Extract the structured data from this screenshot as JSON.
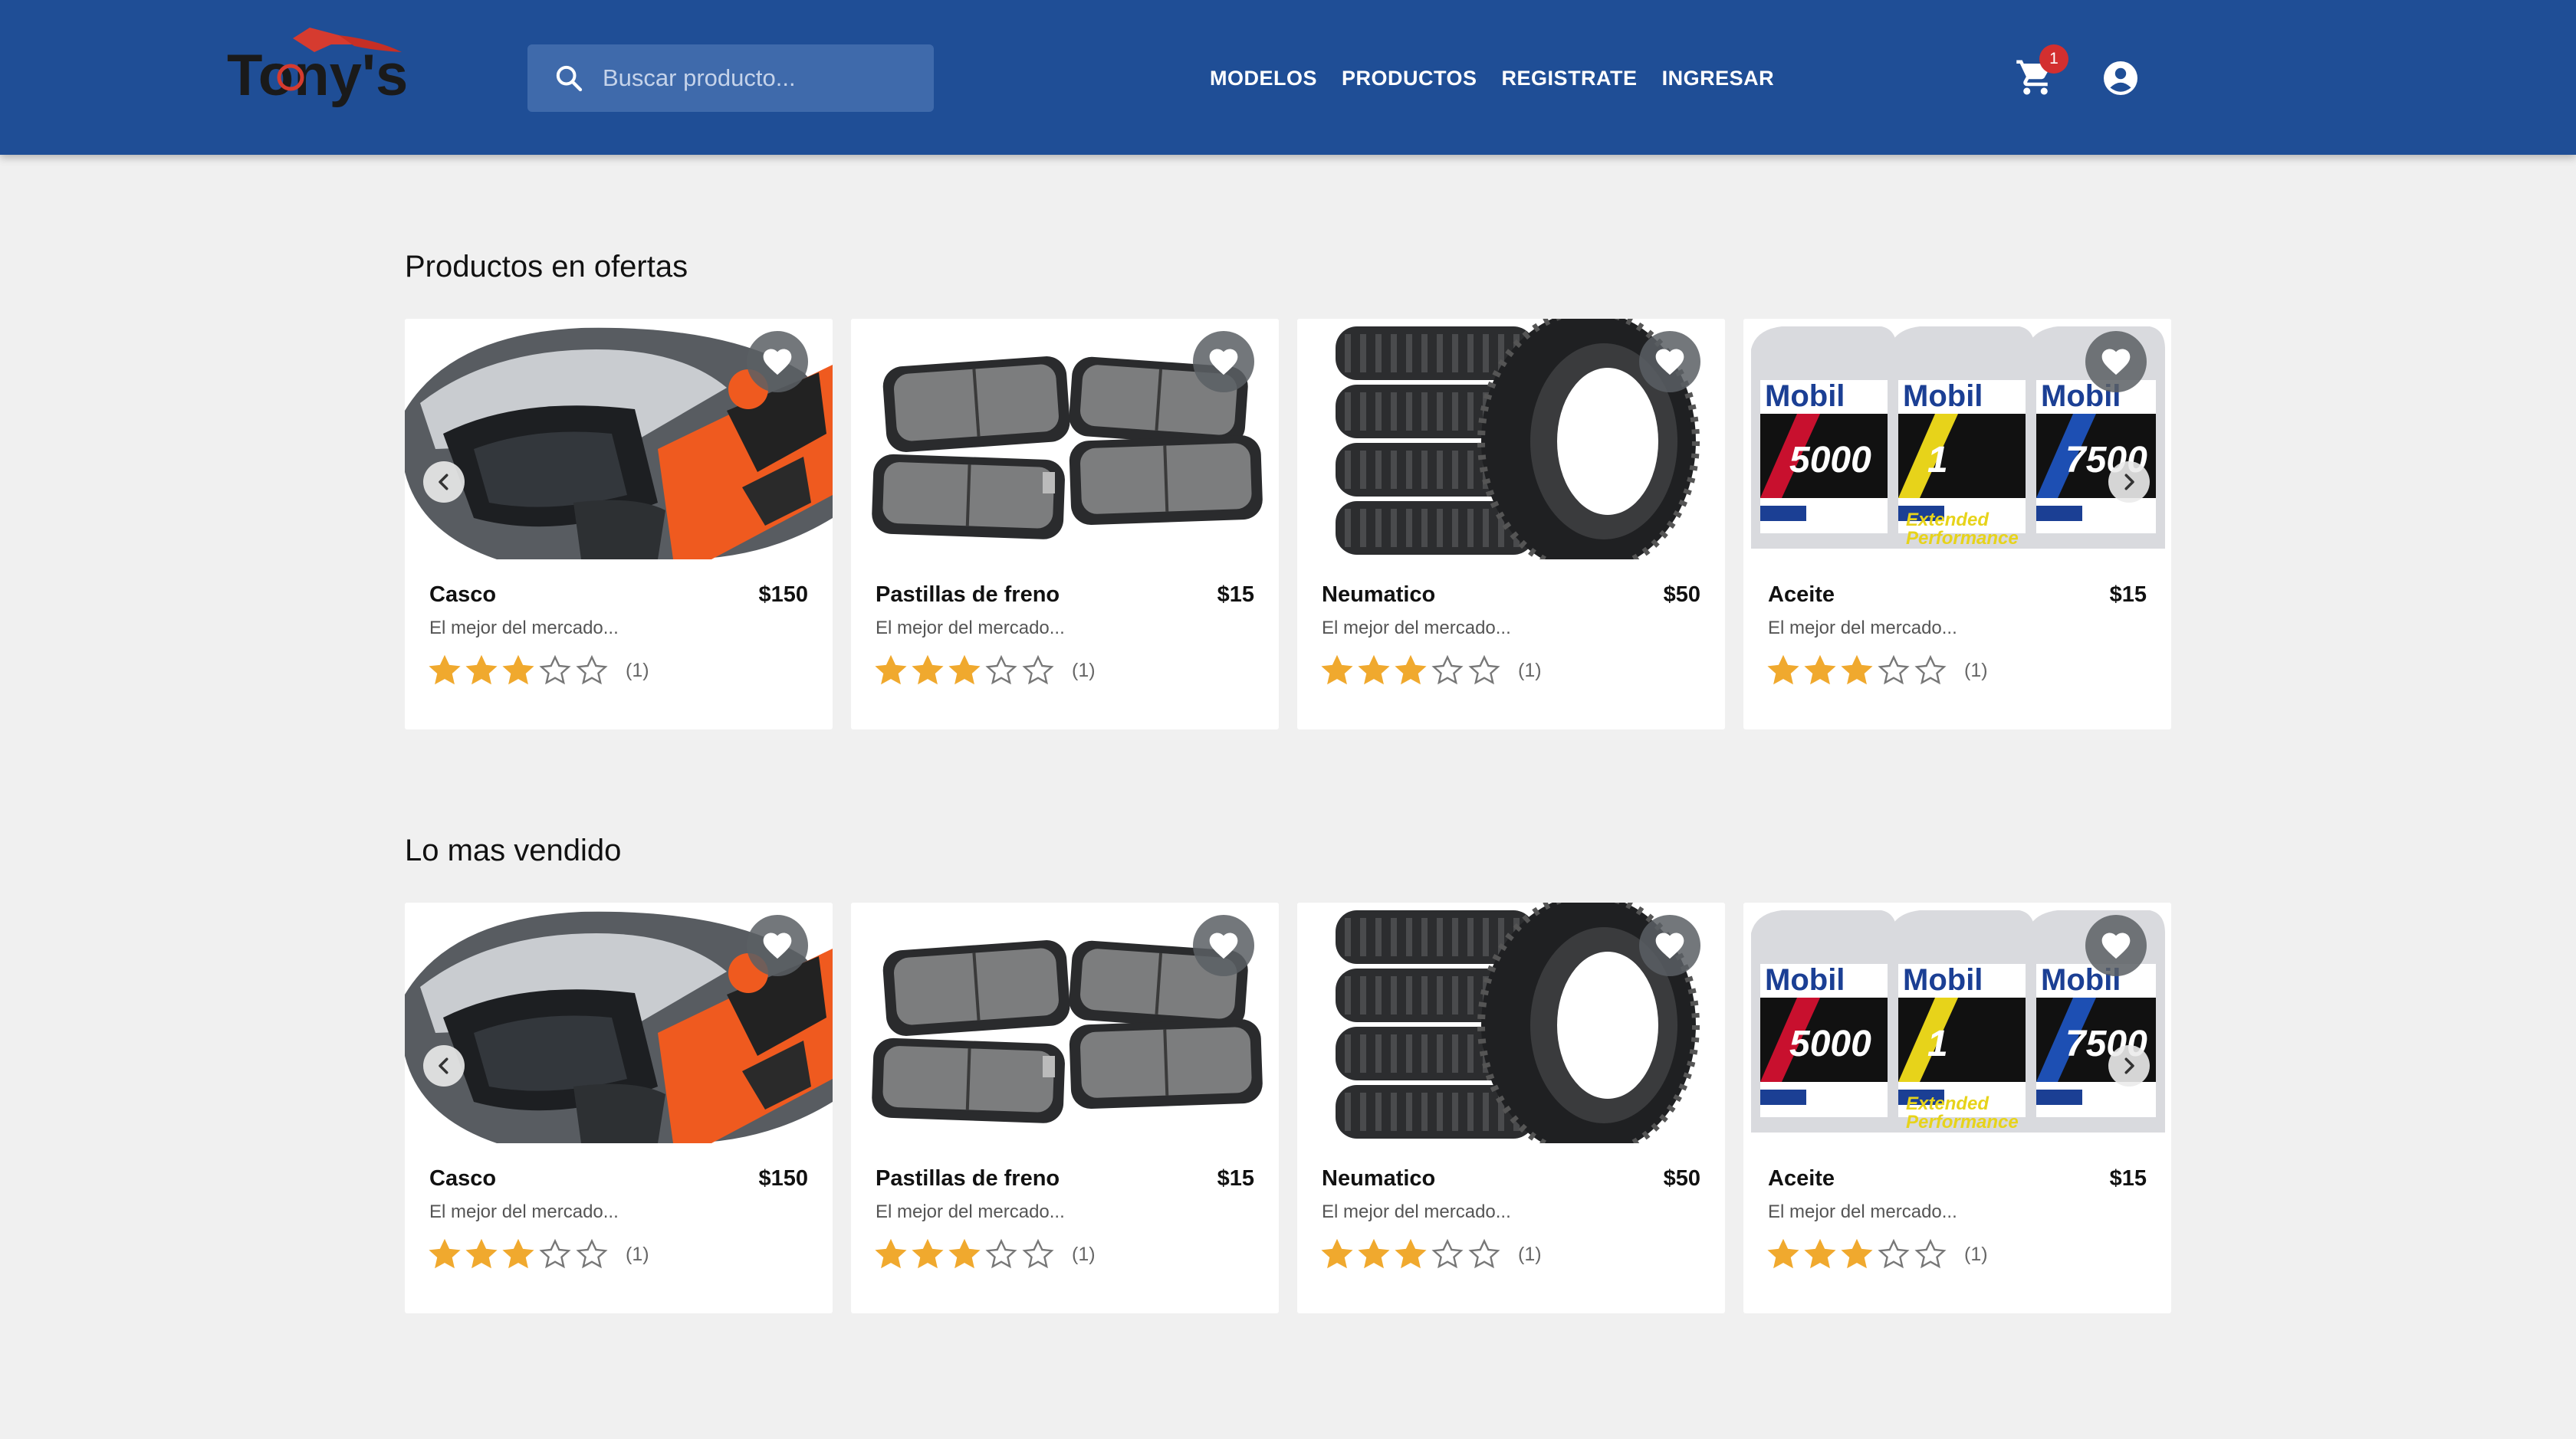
{
  "brand": {
    "logo_text": "Tony's"
  },
  "search": {
    "placeholder": "Buscar producto..."
  },
  "nav": {
    "items": [
      "MODELOS",
      "PRODUCTOS",
      "REGISTRATE",
      "INGRESAR"
    ]
  },
  "cart": {
    "count": "1"
  },
  "icons": {
    "search": "search-icon",
    "cart": "shopping-cart-icon",
    "account": "account-circle-icon",
    "favorite": "heart-icon",
    "prev": "chevron-left-icon",
    "next": "chevron-right-icon",
    "star": "star-icon"
  },
  "colors": {
    "header": "#1f4e96",
    "search_bg": "#3f6aab",
    "star": "#f0a92e",
    "badge": "#d32f2f"
  },
  "sections": [
    {
      "title": "Productos en ofertas",
      "products": [
        {
          "name": "Casco",
          "price": "$150",
          "description": "El mejor del mercado...",
          "rating": 3,
          "rating_count": "(1)",
          "image": "helmet"
        },
        {
          "name": "Pastillas de freno",
          "price": "$15",
          "description": "El mejor del mercado...",
          "rating": 3,
          "rating_count": "(1)",
          "image": "brake-pads"
        },
        {
          "name": "Neumatico",
          "price": "$50",
          "description": "El mejor del mercado...",
          "rating": 3,
          "rating_count": "(1)",
          "image": "tires"
        },
        {
          "name": "Aceite",
          "price": "$15",
          "description": "El mejor del mercado...",
          "rating": 3,
          "rating_count": "(1)",
          "image": "oil",
          "label_texts": [
            "Mobil",
            "5000",
            "Mobil",
            "1",
            "Mobil",
            "7500",
            "Extended",
            "Performance"
          ]
        }
      ]
    },
    {
      "title": "Lo mas vendido",
      "products": [
        {
          "name": "Casco",
          "price": "$150",
          "description": "El mejor del mercado...",
          "rating": 3,
          "rating_count": "(1)",
          "image": "helmet"
        },
        {
          "name": "Pastillas de freno",
          "price": "$15",
          "description": "El mejor del mercado...",
          "rating": 3,
          "rating_count": "(1)",
          "image": "brake-pads"
        },
        {
          "name": "Neumatico",
          "price": "$50",
          "description": "El mejor del mercado...",
          "rating": 3,
          "rating_count": "(1)",
          "image": "tires"
        },
        {
          "name": "Aceite",
          "price": "$15",
          "description": "El mejor del mercado...",
          "rating": 3,
          "rating_count": "(1)",
          "image": "oil",
          "label_texts": [
            "Mobil",
            "5000",
            "Mobil",
            "1",
            "Mobil",
            "7500",
            "Extended",
            "Performance"
          ]
        }
      ]
    }
  ]
}
